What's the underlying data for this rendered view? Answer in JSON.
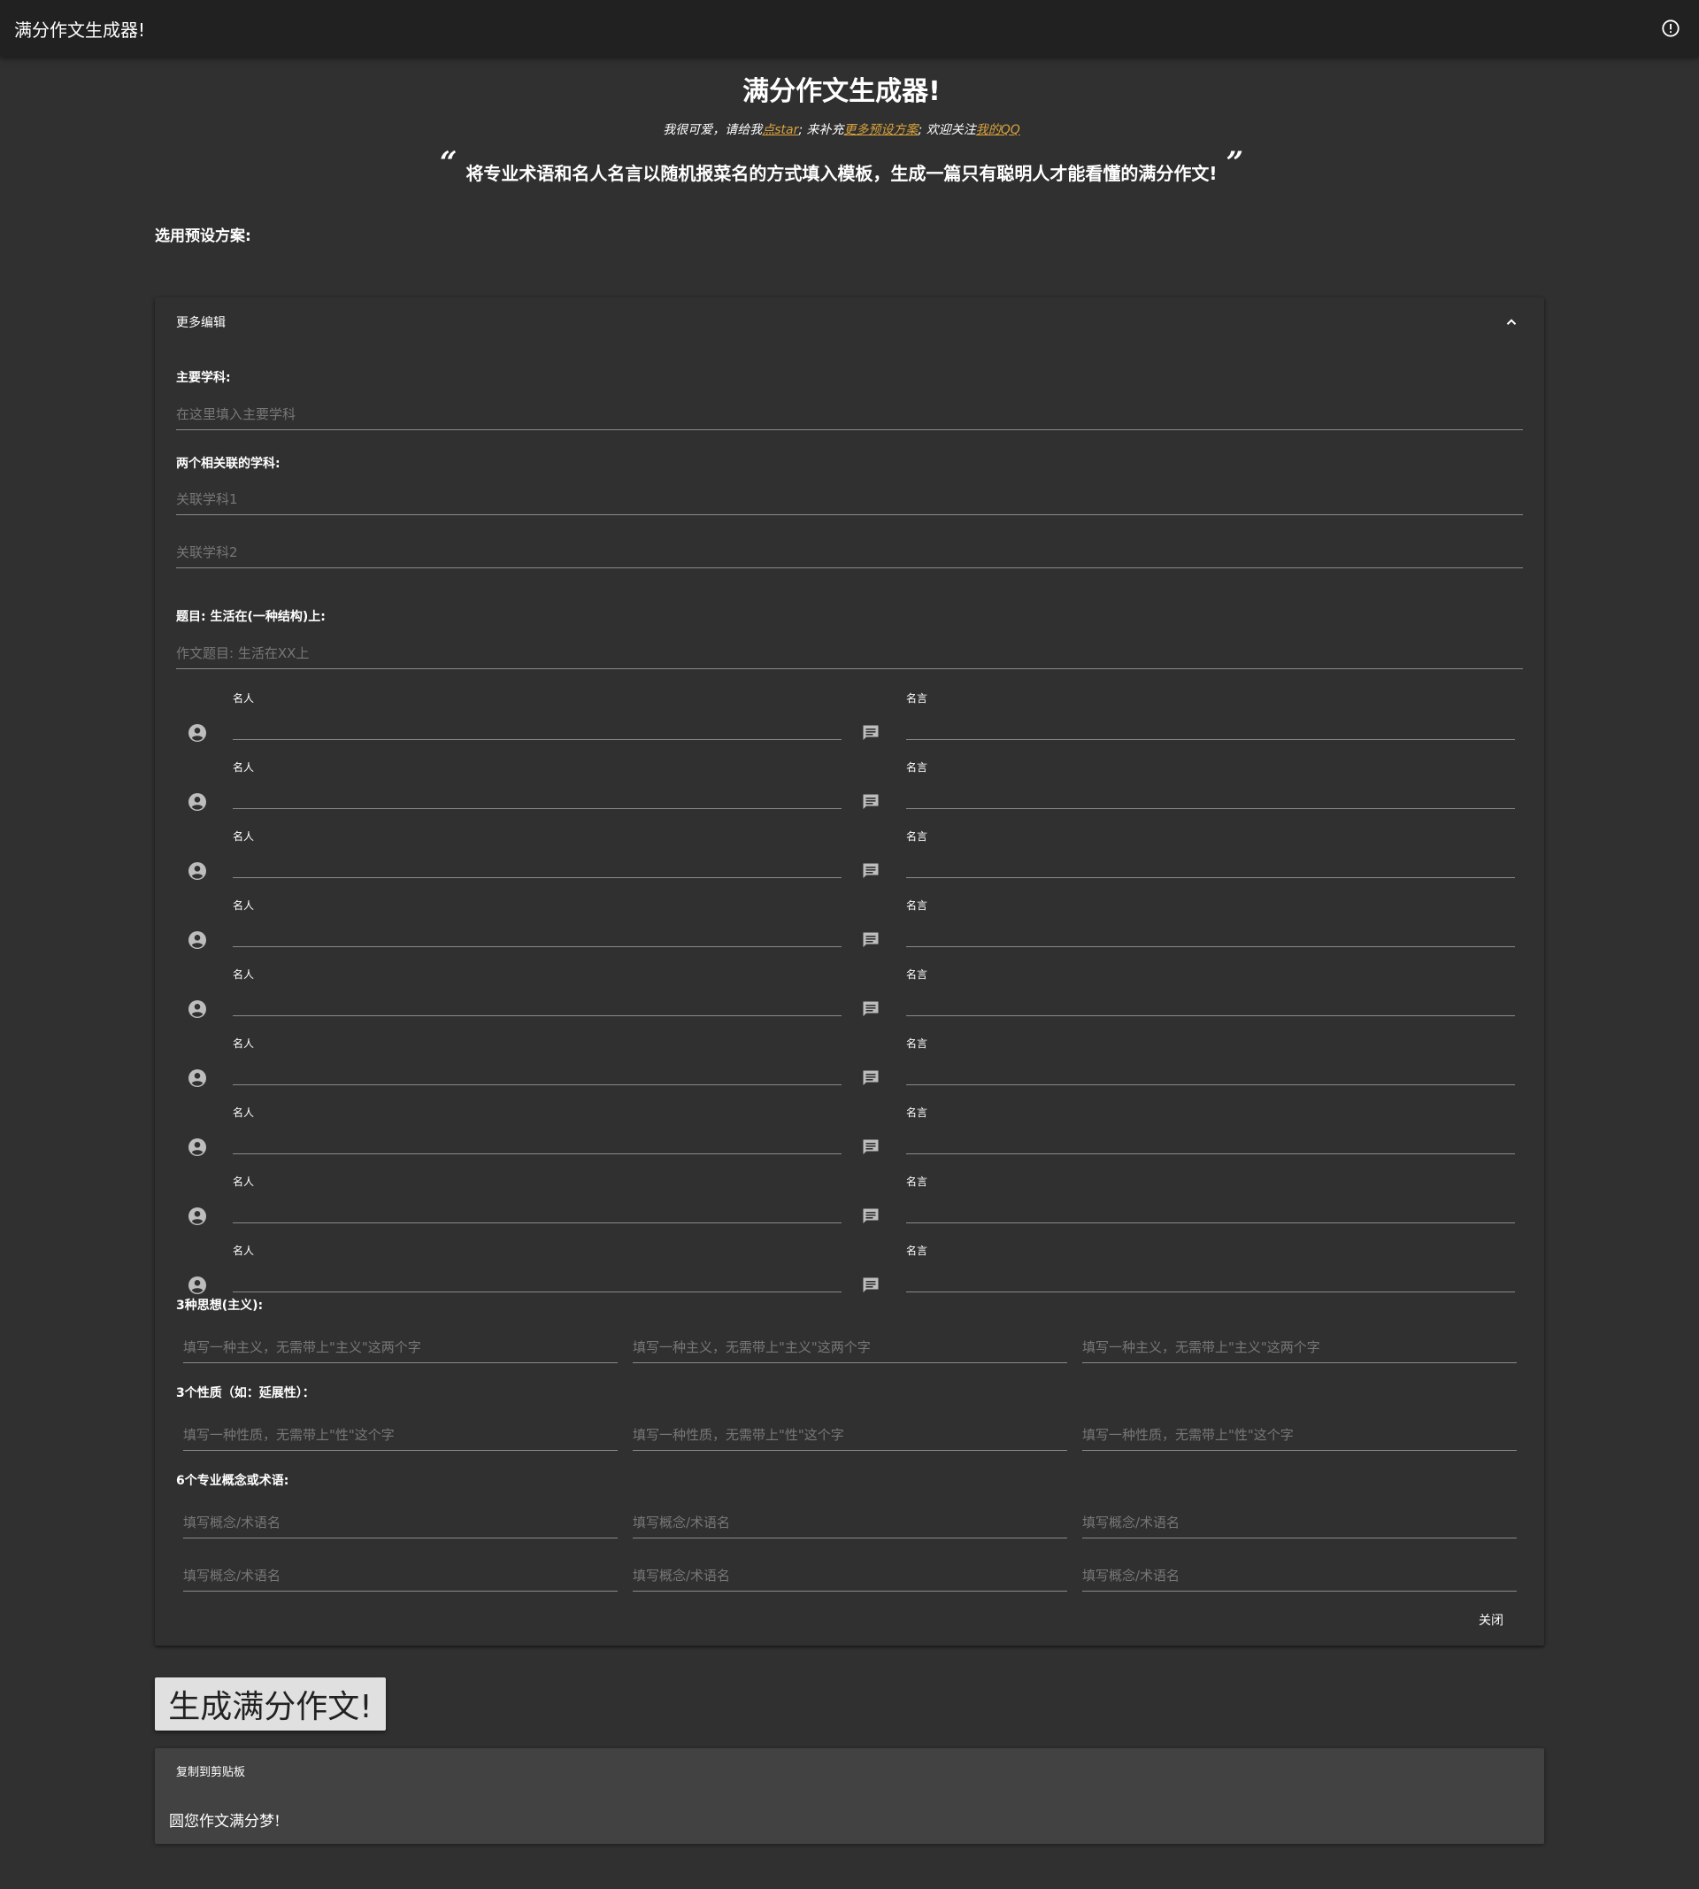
{
  "appbar": {
    "title": "满分作文生成器!",
    "info_icon": "info-circle-icon"
  },
  "header": {
    "title": "满分作文生成器!",
    "sub_1": "我很可爱，请给我",
    "star_link": "点star",
    "sub_2": "; 来补充",
    "preset_link": "更多预设方案",
    "sub_3": "; 欢迎关注",
    "qq_link": "我的QQ",
    "quote_open": "“",
    "quote": "将专业术语和名人名言以随机报菜名的方式填入模板，生成一篇只有聪明人才能看懂的满分作文!",
    "quote_close": "”"
  },
  "preset": {
    "label": "选用预设方案:"
  },
  "panel": {
    "head_label": "更多编辑",
    "subject_label": "主要学科:",
    "subject_placeholder": "在这里填入主要学科",
    "related_label": "两个相关联的学科:",
    "related_1_placeholder": "关联学科1",
    "related_2_placeholder": "关联学科2",
    "topic_label": "题目: 生活在(一种结构)上:",
    "topic_placeholder": "作文题目: 生活在XX上",
    "person_label": "名人",
    "quote_label": "名言",
    "pq_rows": 9,
    "ideology_label": "3种思想(主义):",
    "ideology_placeholder": "填写一种主义，无需带上\"主义\"这两个字",
    "nature_label": "3个性质（如：延展性）：",
    "nature_placeholder": "填写一种性质，无需带上\"性\"这个字",
    "concept_label": "6个专业概念或术语:",
    "concept_placeholder": "填写概念/术语名",
    "close_label": "关闭"
  },
  "generate": {
    "label": "生成满分作文!"
  },
  "output": {
    "copy_label": "复制到剪贴板",
    "text": "圆您作文满分梦!"
  }
}
